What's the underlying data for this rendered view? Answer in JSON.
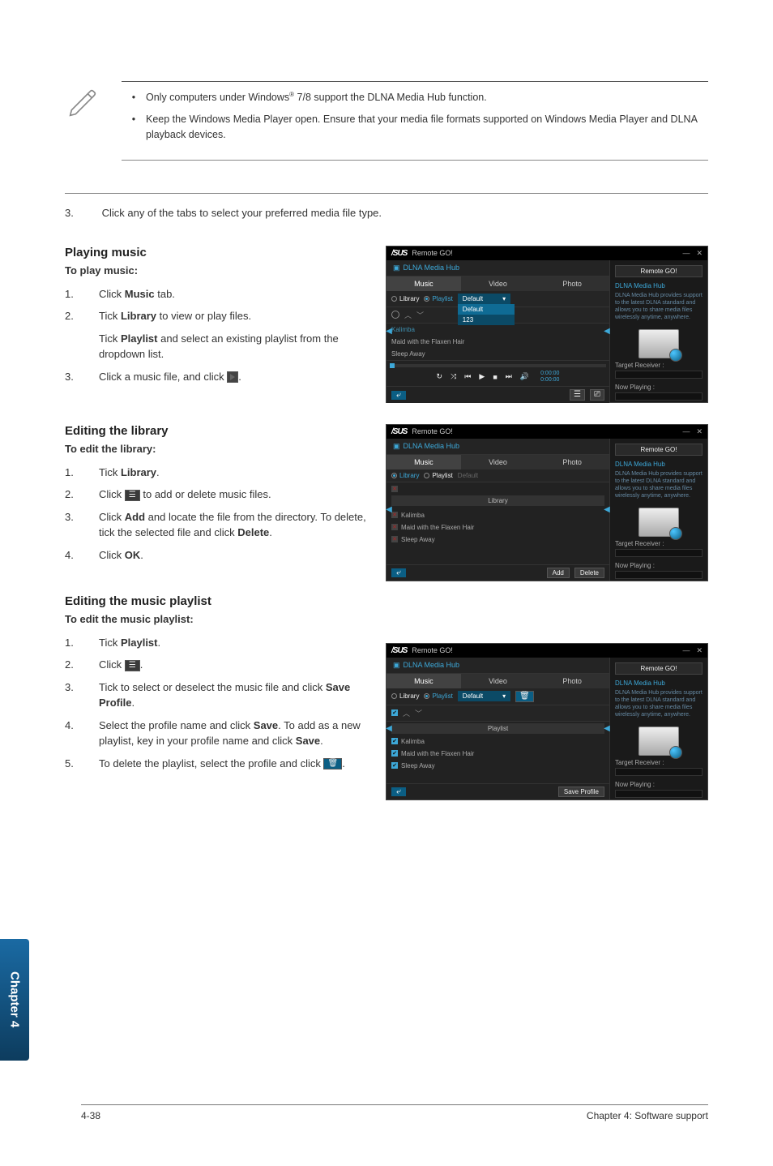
{
  "notes": {
    "bullet1": "Only computers under Windows® 7/8 support the DLNA Media Hub function.",
    "bullet2": "Keep the Windows Media Player open. Ensure that your media file formats supported on Windows Media Player and DLNA playback devices."
  },
  "pre_step": {
    "num": "3.",
    "text": "Click any of the tabs to select your preferred media file type."
  },
  "section1": {
    "title": "Playing music",
    "subtitle": "To play music:",
    "steps": [
      {
        "num": "1.",
        "pre": "Click ",
        "bold": "Music",
        "post": " tab."
      },
      {
        "num": "2.",
        "pre": "Tick ",
        "bold": "Library",
        "post": " to view or play files."
      },
      {
        "num": "3.",
        "pre": "Click a music file, and click ",
        "icon": "play"
      }
    ],
    "indent": {
      "pre": "Tick ",
      "bold": "Playlist",
      "post": " and select an existing playlist from the dropdown list."
    }
  },
  "section2": {
    "title": "Editing the library",
    "subtitle": "To edit the library:",
    "steps": [
      {
        "num": "1.",
        "pre": "Tick ",
        "bold": "Library",
        "post": "."
      },
      {
        "num": "2.",
        "pre": "Click ",
        "icon": "list",
        "post": " to add or delete music files."
      },
      {
        "num": "3.",
        "pre": "Click ",
        "bold": "Add",
        "mid": " and locate the file from the directory. To delete, tick the selected file and click ",
        "bold2": "Delete",
        "post2": "."
      },
      {
        "num": "4.",
        "pre": "Click ",
        "bold": "OK",
        "post": "."
      }
    ]
  },
  "section3": {
    "title": "Editing the music playlist",
    "subtitle": "To edit the music playlist:",
    "steps": [
      {
        "num": "1.",
        "pre": "Tick ",
        "bold": "Playlist",
        "post": "."
      },
      {
        "num": "2.",
        "pre": "Click ",
        "icon": "list",
        "post": "."
      },
      {
        "num": "3.",
        "pre": "Tick to select or deselect the music file and click ",
        "bold": "Save Profile",
        "post": "."
      },
      {
        "num": "4.",
        "pre": "Select the profile name and click ",
        "bold": "Save",
        "mid": ". To add as a new playlist, key in your profile name and click ",
        "bold2": "Save",
        "post2": "."
      },
      {
        "num": "5.",
        "pre": "To delete the playlist, select the profile and click ",
        "icon": "trash",
        "post": "."
      }
    ]
  },
  "app": {
    "title": "Remote GO!",
    "logo": "/SUS",
    "sub_title": "DLNA Media Hub",
    "tabs": {
      "music": "Music",
      "video": "Video",
      "photo": "Photo"
    },
    "library_label": "Library",
    "playlist_label": "Playlist",
    "default_label": "Default",
    "dd_item2": "123",
    "lib_header": "Library",
    "playlist_header": "Playlist",
    "tracks": [
      "Kalimba",
      "Maid with the Flaxen Hair",
      "Sleep Away"
    ],
    "time1": "0:00:00",
    "time2": "0:00:00",
    "side": {
      "btn": "Remote GO!",
      "head": "DLNA Media Hub",
      "desc": "DLNA Media Hub provides support to the latest DLNA standard and allows you to share media files wirelessly anytime, anywhere.",
      "target": "Target Receiver :",
      "playing": "Now Playing :"
    },
    "buttons": {
      "add": "Add",
      "delete": "Delete",
      "save_profile": "Save Profile",
      "back": "⤶"
    }
  },
  "chapter_tab": "Chapter 4",
  "footer": {
    "left": "4-38",
    "right": "Chapter 4: Software support"
  }
}
